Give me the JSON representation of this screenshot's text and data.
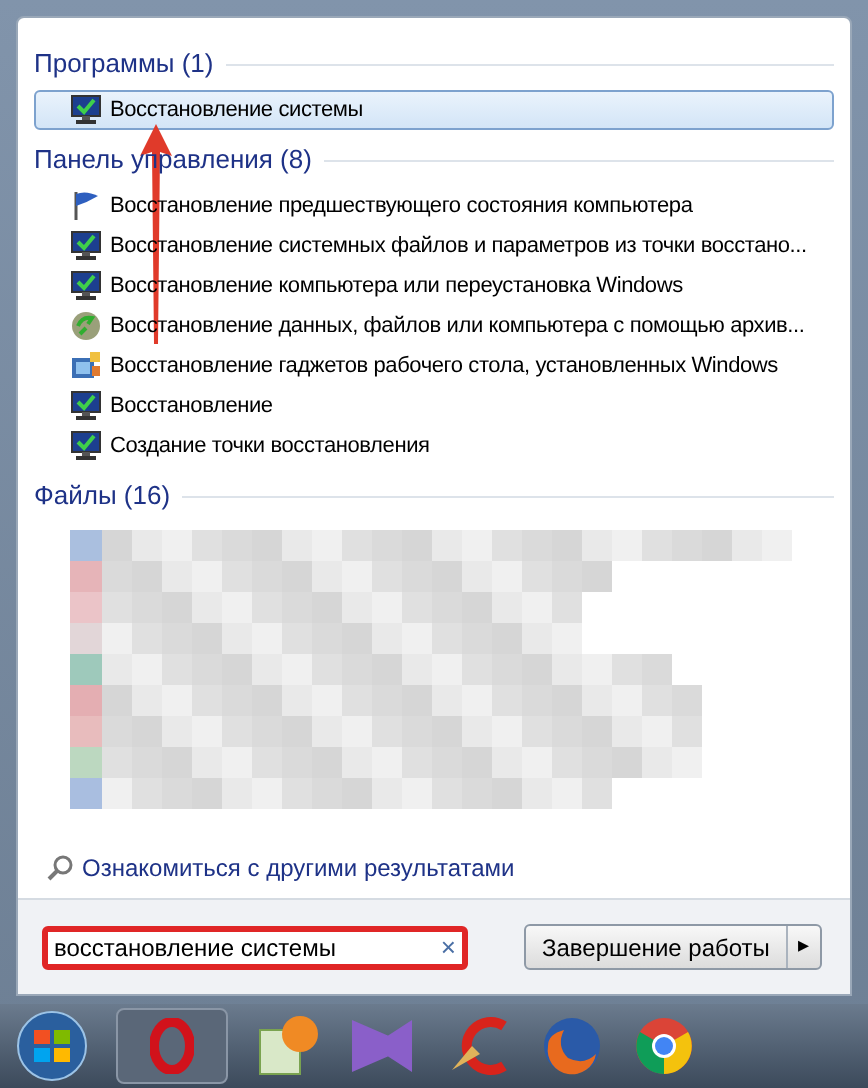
{
  "groups": [
    {
      "title": "Программы (1)",
      "items": [
        {
          "label": "Восстановление системы",
          "kind": "monitor",
          "selected": true
        }
      ]
    },
    {
      "title": "Панель управления (8)",
      "items": [
        {
          "label": "Восстановление предшествующего состояния компьютера",
          "kind": "flag",
          "selected": false
        },
        {
          "label": "Восстановление системных файлов и параметров из точки восстано...",
          "kind": "monitor",
          "selected": false
        },
        {
          "label": "Восстановление компьютера или переустановка Windows",
          "kind": "monitor",
          "selected": false
        },
        {
          "label": "Восстановление данных, файлов или компьютера с помощью архив...",
          "kind": "backup",
          "selected": false
        },
        {
          "label": "Восстановление гаджетов рабочего стола, установленных Windows",
          "kind": "gadgets",
          "selected": false
        },
        {
          "label": "Восстановление",
          "kind": "monitor",
          "selected": false
        },
        {
          "label": "Создание точки восстановления",
          "kind": "monitor",
          "selected": false
        }
      ]
    },
    {
      "title": "Файлы (16)",
      "kind": "blurred"
    }
  ],
  "more_results": "Ознакомиться с другими результатами",
  "search": {
    "value": "восстановление системы",
    "clear": "×"
  },
  "shutdown": {
    "label": "Завершение работы",
    "arrow": "▸"
  }
}
